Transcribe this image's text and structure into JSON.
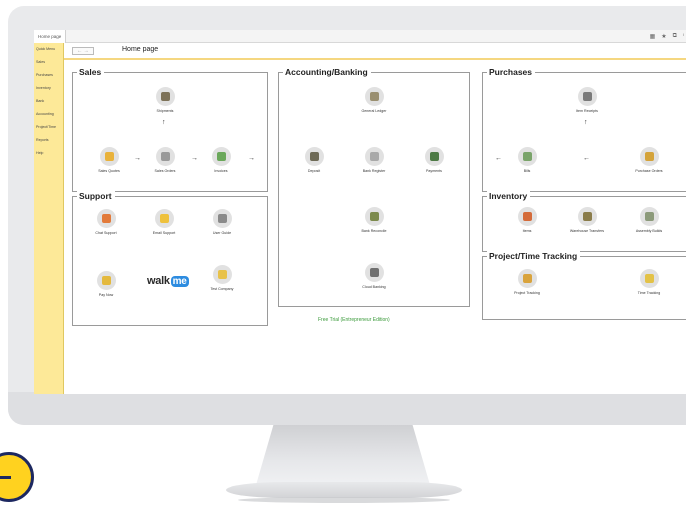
{
  "tabbar": {
    "tab_label": "Home page",
    "icons": [
      "grid-icon",
      "star-icon",
      "copy-icon",
      "info-icon"
    ],
    "icon_glyphs": [
      "▦",
      "★",
      "⧉",
      "ⁱ"
    ]
  },
  "sidebar": {
    "items": [
      "Quick Menu",
      "Sales",
      "Purchases",
      "Inventory",
      "Bank",
      "Accounting",
      "Project/Time",
      "Reports",
      "Help"
    ]
  },
  "breadcrumb": {
    "nav": "← →",
    "title": "Home page"
  },
  "sales": {
    "title": "Sales",
    "nodes": [
      {
        "key": "shipments",
        "label": "Shipments",
        "color": "#7d7258"
      },
      {
        "key": "sales_quotes",
        "label": "Sales Quotes",
        "color": "#e9b23b"
      },
      {
        "key": "sales_orders",
        "label": "Sales Orders",
        "color": "#9a9a9a"
      },
      {
        "key": "invoices",
        "label": "Invoices",
        "color": "#6ba85b"
      }
    ]
  },
  "support": {
    "title": "Support",
    "nodes": [
      {
        "key": "chat_support",
        "label": "Chat Support",
        "color": "#e27a3a"
      },
      {
        "key": "email_support",
        "label": "Email Support",
        "color": "#eec13c"
      },
      {
        "key": "user_guide",
        "label": "User Guide",
        "color": "#8a8a8a"
      },
      {
        "key": "pay_now",
        "label": "Pay Now",
        "color": "#e4b93e"
      },
      {
        "key": "test_company",
        "label": "Test Company",
        "color": "#e8c24a"
      }
    ],
    "walkme": {
      "walk": "walk",
      "me": "me"
    }
  },
  "accounting": {
    "title": "Accounting/Banking",
    "nodes": [
      {
        "key": "general_ledger",
        "label": "General Ledger",
        "color": "#9a8f70"
      },
      {
        "key": "deposit",
        "label": "Deposit",
        "color": "#6e6a56"
      },
      {
        "key": "bank_register",
        "label": "Bank Register",
        "color": "#a9a9a9"
      },
      {
        "key": "payments",
        "label": "Payments",
        "color": "#4d7a45"
      },
      {
        "key": "bank_reconcile",
        "label": "Bank Reconcile",
        "color": "#7c8a4c"
      },
      {
        "key": "cloud_banking",
        "label": "Cloud Banking",
        "color": "#6f6f6f"
      }
    ],
    "free_trial": "Free Trial (Entrepreneur Edition)"
  },
  "purchases": {
    "title": "Purchases",
    "nodes": [
      {
        "key": "item_receipts",
        "label": "Item Receipts",
        "color": "#7a7a7a"
      },
      {
        "key": "bills",
        "label": "Bills",
        "color": "#7aa46a"
      },
      {
        "key": "purchase_orders",
        "label": "Purchase Orders",
        "color": "#d4a33a"
      }
    ]
  },
  "inventory": {
    "title": "Inventory",
    "nodes": [
      {
        "key": "items",
        "label": "Items",
        "color": "#d46b3a"
      },
      {
        "key": "warehouse_transfers",
        "label": "Warehouse Transfers",
        "color": "#8a7c4a"
      },
      {
        "key": "assembly_builds",
        "label": "Assembly Builds",
        "color": "#8c9a7a"
      }
    ]
  },
  "project": {
    "title": "Project/Time Tracking",
    "nodes": [
      {
        "key": "project_tracking",
        "label": "Project Tracking",
        "color": "#d9a33c"
      },
      {
        "key": "time_tracking",
        "label": "Time Tracking",
        "color": "#e3c247"
      }
    ]
  },
  "arrows": {
    "right": "→",
    "up": "↑",
    "left": "←"
  }
}
